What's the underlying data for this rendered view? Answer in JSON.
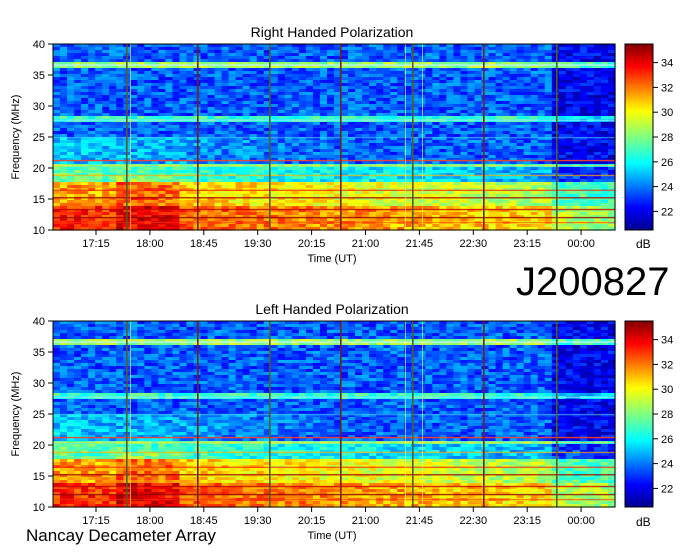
{
  "observation_id": "J200827",
  "footer_text": "Nancay Decameter Array",
  "chart_data": [
    {
      "type": "heatmap",
      "title": "Right Handed Polarization",
      "xlabel": "Time (UT)",
      "ylabel": "Frequency (MHz)",
      "ylim": [
        10,
        40
      ],
      "yticks": [
        "10",
        "15",
        "20",
        "25",
        "30",
        "35",
        "40"
      ],
      "xticks": [
        "17:15",
        "18:00",
        "18:45",
        "19:30",
        "20:15",
        "21:00",
        "21:45",
        "22:30",
        "23:15",
        "00:00"
      ],
      "colorbar_ticks": [
        "22",
        "24",
        "26",
        "28",
        "30",
        "32",
        "34"
      ],
      "colorbar_unit": "dB",
      "colorbar_range": [
        20.5,
        35.5
      ]
    },
    {
      "type": "heatmap",
      "title": "Left Handed Polarization",
      "xlabel": "Time (UT)",
      "ylabel": "Frequency (MHz)",
      "ylim": [
        10,
        40
      ],
      "yticks": [
        "10",
        "15",
        "20",
        "25",
        "30",
        "35",
        "40"
      ],
      "xticks": [
        "17:15",
        "18:00",
        "18:45",
        "19:30",
        "20:15",
        "21:00",
        "21:45",
        "22:30",
        "23:15",
        "00:00"
      ],
      "colorbar_ticks": [
        "22",
        "24",
        "26",
        "28",
        "30",
        "32",
        "34"
      ],
      "colorbar_unit": "dB",
      "colorbar_range": [
        20.5,
        35.5
      ]
    }
  ]
}
